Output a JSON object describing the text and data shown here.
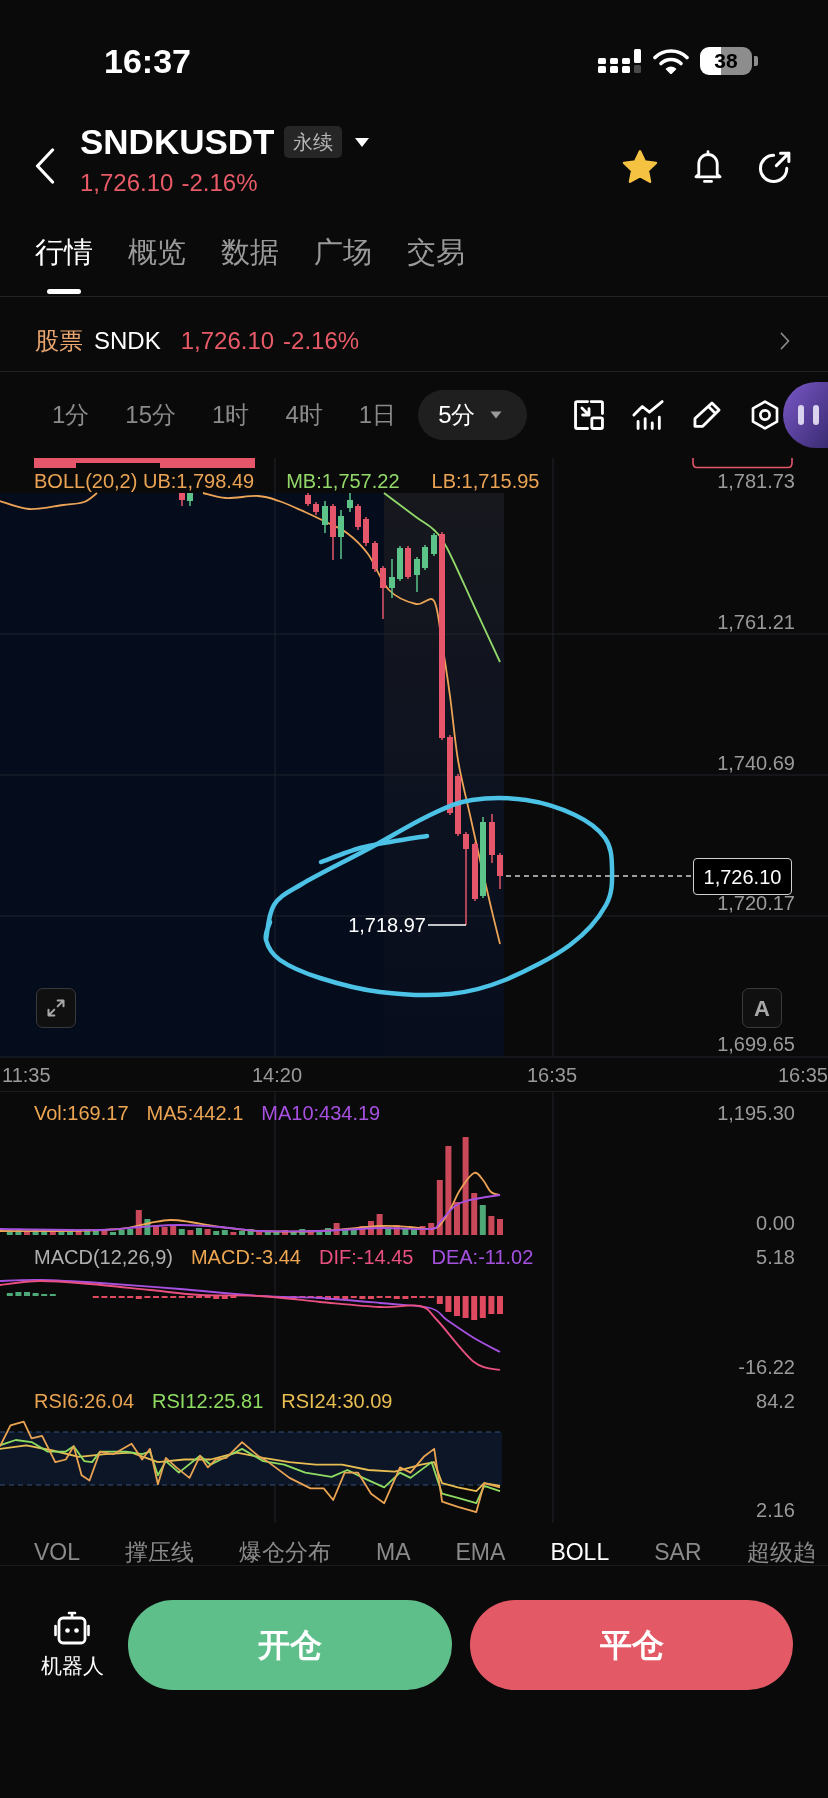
{
  "status_bar": {
    "time": "16:37",
    "battery": "38"
  },
  "header": {
    "symbol": "SNDKUSDT",
    "badge": "永续",
    "price": "1,726.10",
    "change": "-2.16%",
    "favorite": true
  },
  "tabs": [
    {
      "label": "行情",
      "selected": true
    },
    {
      "label": "概览",
      "selected": false
    },
    {
      "label": "数据",
      "selected": false
    },
    {
      "label": "广场",
      "selected": false
    },
    {
      "label": "交易",
      "selected": false
    }
  ],
  "stock_row": {
    "label": "股票",
    "ticker": "SNDK",
    "price": "1,726.10",
    "change": "-2.16%"
  },
  "timeframes": [
    {
      "label": "1分",
      "selected": false
    },
    {
      "label": "15分",
      "selected": false
    },
    {
      "label": "1时",
      "selected": false
    },
    {
      "label": "4时",
      "selected": false
    },
    {
      "label": "1日",
      "selected": false
    },
    {
      "label": "5分",
      "selected": true
    }
  ],
  "main_chart": {
    "legend": [
      {
        "text": "BOLL(20,2) UB:1,798.49",
        "color": "#eba455"
      },
      {
        "text": "MB:1,757.22",
        "color": "#93d96a"
      },
      {
        "text": "LB:1,715.95",
        "color": "#eba455"
      }
    ],
    "price_axis": [
      "1,781.73",
      "1,761.21",
      "1,740.69",
      "1,720.17",
      "1,699.65"
    ],
    "current_price": "1,726.10",
    "low_price": "1,718.97",
    "auto_button": "A",
    "time_axis": [
      "11:35",
      "14:20",
      "16:35",
      "16:35"
    ]
  },
  "volume_chart": {
    "legend": [
      {
        "text": "Vol:169.17",
        "color": "#eda652"
      },
      {
        "text": "MA5:442.1",
        "color": "#eba455"
      },
      {
        "text": "MA10:434.19",
        "color": "#a651e0"
      }
    ],
    "axis": [
      "1,195.30",
      "0.00"
    ]
  },
  "macd_chart": {
    "legend": [
      {
        "text": "MACD(12,26,9)",
        "color": "#b0b0b0"
      },
      {
        "text": "MACD:-3.44",
        "color": "#eda652"
      },
      {
        "text": "DIF:-14.45",
        "color": "#e8507f"
      },
      {
        "text": "DEA:-11.02",
        "color": "#a651e0"
      }
    ],
    "axis": [
      "5.18",
      "-16.22"
    ]
  },
  "rsi_chart": {
    "legend": [
      {
        "text": "RSI6:26.04",
        "color": "#e9a352"
      },
      {
        "text": "RSI12:25.81",
        "color": "#8fdc62"
      },
      {
        "text": "RSI24:30.09",
        "color": "#e8bd52"
      }
    ],
    "axis": [
      "84.2",
      "2.16"
    ]
  },
  "indicators": [
    {
      "label": "VOL",
      "selected": false
    },
    {
      "label": "撑压线",
      "selected": false
    },
    {
      "label": "爆仓分布",
      "selected": false
    },
    {
      "label": "MA",
      "selected": false
    },
    {
      "label": "EMA",
      "selected": false
    },
    {
      "label": "BOLL",
      "selected": true
    },
    {
      "label": "SAR",
      "selected": false
    },
    {
      "label": "超级趋",
      "selected": false
    }
  ],
  "bottom_bar": {
    "robot_label": "机器人",
    "buttons": [
      {
        "label": "开仓",
        "kind": "open"
      },
      {
        "label": "平仓",
        "kind": "close"
      }
    ]
  }
}
